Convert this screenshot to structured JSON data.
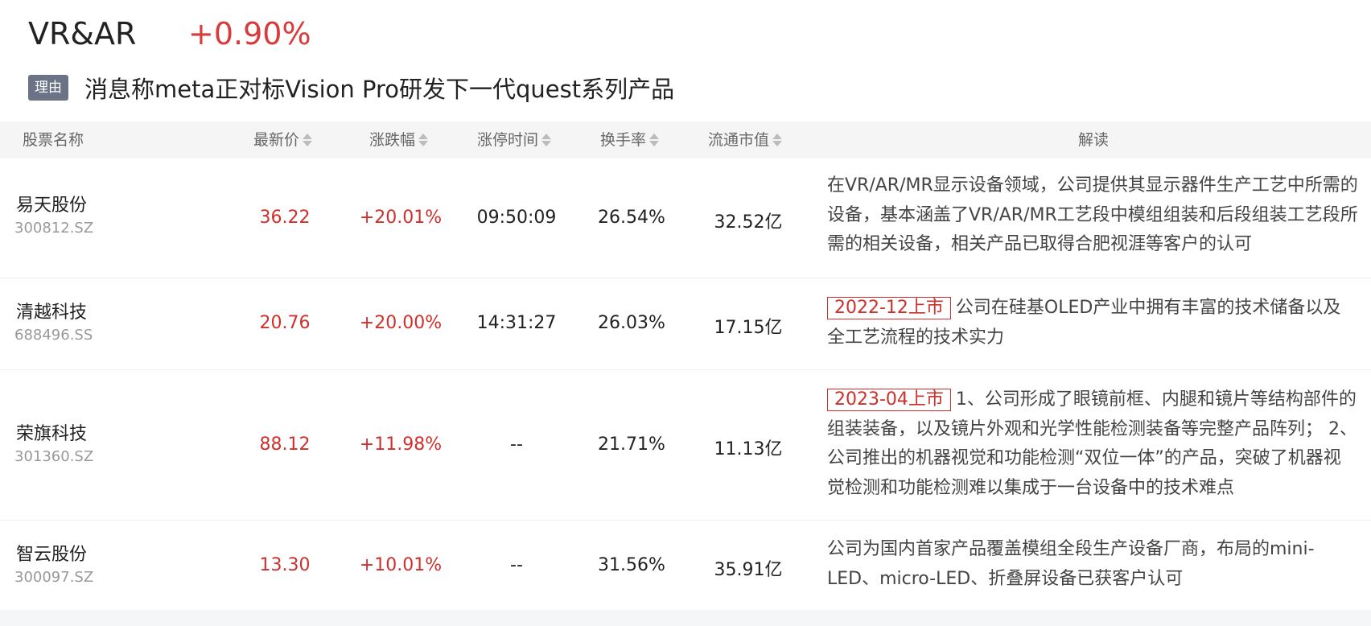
{
  "sector": {
    "name": "VR&AR",
    "change": "+0.90%",
    "reason_tag": "理由",
    "reason_text": "消息称meta正对标Vision Pro研发下一代quest系列产品"
  },
  "table": {
    "headers": {
      "name": "股票名称",
      "price": "最新价",
      "change": "涨跌幅",
      "limit_time": "涨停时间",
      "turnover": "换手率",
      "market_cap": "流通市值",
      "interpretation": "解读"
    },
    "rows": [
      {
        "name": "易天股份",
        "code": "300812.SZ",
        "price": "36.22",
        "change": "+20.01%",
        "limit_time": "09:50:09",
        "turnover": "26.54%",
        "market_cap": "32.52亿",
        "ipo_tag": "",
        "desc": "在VR/AR/MR显示设备领域，公司提供其显示器件生产工艺中所需的设备，基本涵盖了VR/AR/MR工艺段中模组组装和后段组装工艺段所需的相关设备，相关产品已取得合肥视涯等客户的认可"
      },
      {
        "name": "清越科技",
        "code": "688496.SS",
        "price": "20.76",
        "change": "+20.00%",
        "limit_time": "14:31:27",
        "turnover": "26.03%",
        "market_cap": "17.15亿",
        "ipo_tag": "2022-12上市",
        "desc": "公司在硅基OLED产业中拥有丰富的技术储备以及全工艺流程的技术实力"
      },
      {
        "name": "荣旗科技",
        "code": "301360.SZ",
        "price": "88.12",
        "change": "+11.98%",
        "limit_time": "--",
        "turnover": "21.71%",
        "market_cap": "11.13亿",
        "ipo_tag": "2023-04上市",
        "desc": "1、公司形成了眼镜前框、内腿和镜片等结构部件的组装装备，以及镜片外观和光学性能检测装备等完整产品阵列； 2、公司推出的机器视觉和功能检测“双位一体”的产品，突破了机器视觉检测和功能检测难以集成于一台设备中的技术难点"
      },
      {
        "name": "智云股份",
        "code": "300097.SZ",
        "price": "13.30",
        "change": "+10.01%",
        "limit_time": "--",
        "turnover": "31.56%",
        "market_cap": "35.91亿",
        "ipo_tag": "",
        "desc": "公司为国内首家产品覆盖模组全段生产设备厂商，布局的mini-LED、micro-LED、折叠屏设备已获客户认可"
      }
    ]
  },
  "colors": {
    "up": "#d0302b",
    "tag_bg": "#6b7387",
    "header_bg": "#f5f5f5"
  }
}
